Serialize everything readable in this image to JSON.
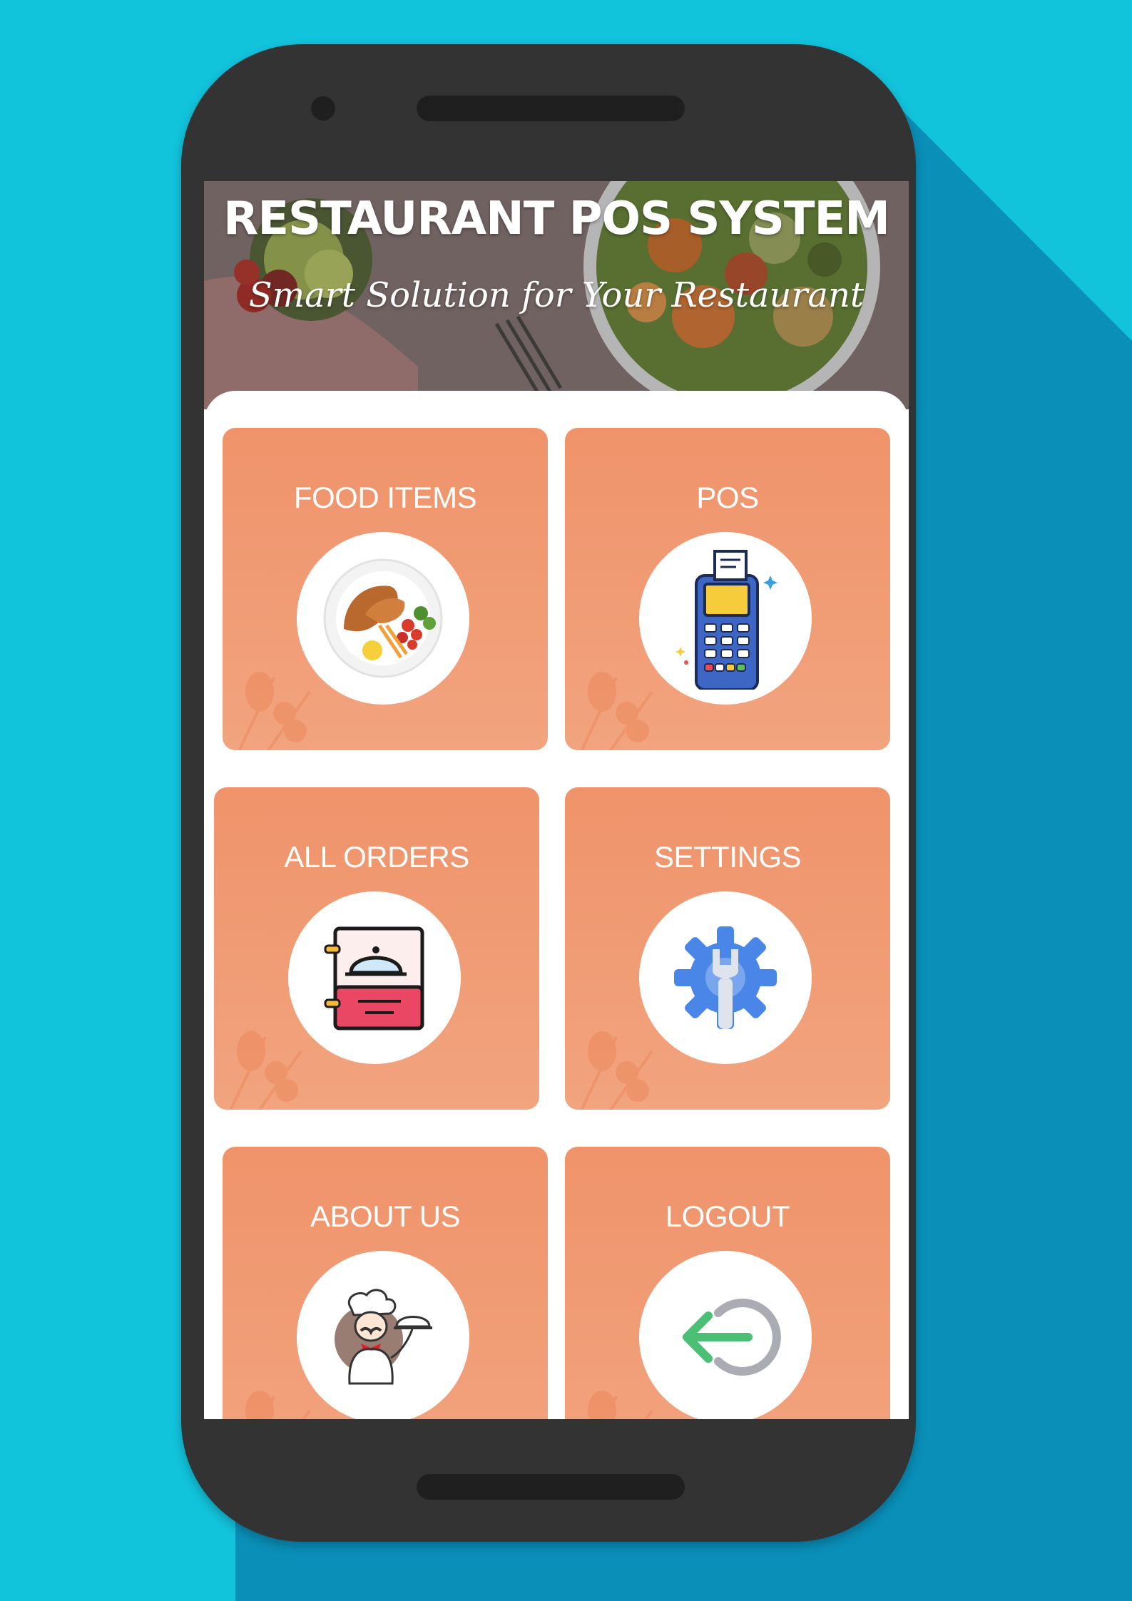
{
  "app": {
    "title": "RESTAURANT POS SYSTEM",
    "subtitle": "Smart Solution for Your Restaurant"
  },
  "colors": {
    "background": "#12c3dc",
    "phone_body": "#333333",
    "tile_top": "#f0936b",
    "tile_bottom": "#f1a47e"
  },
  "menu": [
    {
      "label": "FOOD ITEMS",
      "icon": "food-plate-icon"
    },
    {
      "label": "POS",
      "icon": "pos-terminal-icon"
    },
    {
      "label": "ALL ORDERS",
      "icon": "order-book-icon"
    },
    {
      "label": "SETTINGS",
      "icon": "gear-wrench-icon"
    },
    {
      "label": "ABOUT US",
      "icon": "chef-icon"
    },
    {
      "label": "LOGOUT",
      "icon": "logout-icon"
    }
  ]
}
